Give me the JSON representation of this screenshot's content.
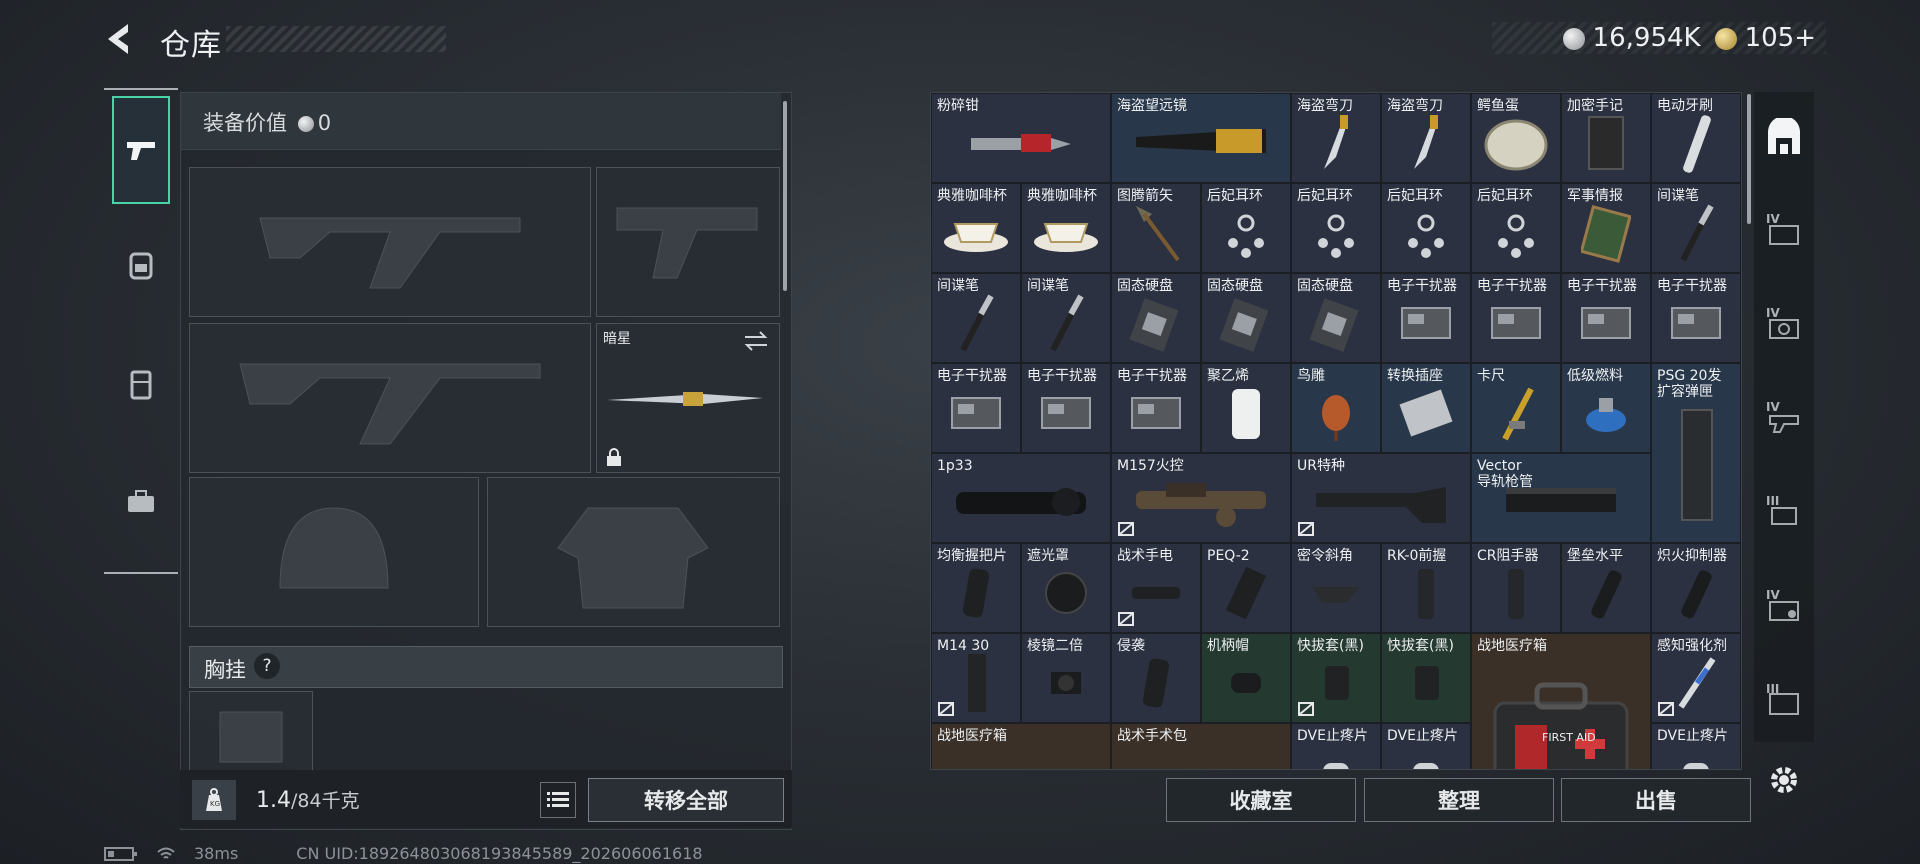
{
  "header": {
    "title": "仓库",
    "currency_silver": "16,954K",
    "currency_gold": "105+"
  },
  "left_nav": [
    {
      "icon": "pistol-icon",
      "active": true
    },
    {
      "icon": "backpack-icon"
    },
    {
      "icon": "vest-icon"
    },
    {
      "icon": "toolbox-icon"
    }
  ],
  "equipment": {
    "value_label": "装备价值",
    "value": "0",
    "melee_name": "暗星",
    "chest_label": "胸挂",
    "help_label": "?",
    "weight_current": "1.4",
    "weight_max": "/84千克",
    "weight_icon_text": "KG",
    "transfer_all": "转移全部"
  },
  "status_bar": {
    "ping": "38ms",
    "uid": "CN UID:18926480306819384​5589_202606061618"
  },
  "stash": {
    "rows": [
      [
        "粉碎钳",
        "海盗望远镜",
        "",
        "海盗弯刀",
        "海盗弯刀",
        "鳄鱼蛋",
        "加密手记",
        "电动牙刷"
      ],
      [
        "典雅咖啡杯",
        "典雅咖啡杯",
        "图腾箭矢",
        "后妃耳环",
        "后妃耳环",
        "后妃耳环",
        "后妃耳环",
        "军事情报",
        "间谍笔"
      ],
      [
        "间谍笔",
        "间谍笔",
        "固态硬盘",
        "固态硬盘",
        "固态硬盘",
        "电子干扰器",
        "电子干扰器",
        "电子干扰器",
        "电子干扰器"
      ],
      [
        "电子干扰器",
        "电子干扰器",
        "电子干扰器",
        "聚乙烯",
        "鸟雕",
        "转换插座",
        "卡尺",
        "低级燃料",
        "PSG 20发"
      ],
      [
        "1p33",
        "M157火控",
        "UR特种",
        "Vector"
      ],
      [
        "均衡握把片",
        "遮光罩",
        "战术手电",
        "PEQ-2",
        "密令斜角",
        "RK-0前握",
        "CR阻手器",
        "堡垒水平",
        "炽火抑制器"
      ],
      [
        "M14 30",
        "棱镜二倍",
        "侵袭",
        "机柄帽",
        "快拔套(黑)",
        "快拔套(黑)",
        "战地医疗箱",
        "感知强化剂"
      ],
      [
        "战地医疗箱",
        "战术手术包",
        "DVE止疼片",
        "DVE止疼片",
        "DVE止疼片"
      ]
    ],
    "psg_sub": "扩容弹匣",
    "vector_sub": "导轨枪管",
    "first_aid": "FIRST AID"
  },
  "actions": {
    "collection": "收藏室",
    "sort": "整理",
    "sell": "出售"
  },
  "tabs": [
    "IV",
    "IV",
    "IV",
    "III",
    "IV",
    "III"
  ]
}
